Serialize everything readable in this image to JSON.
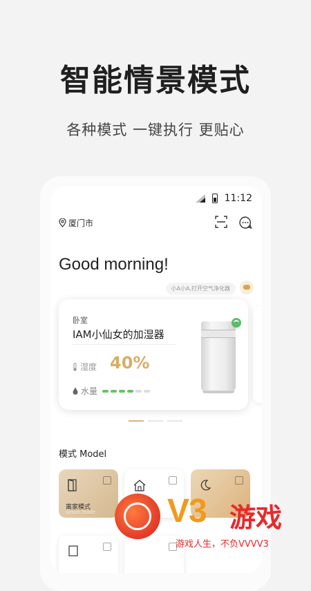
{
  "headline": "智能情景模式",
  "subline": "各种模式 一键执行 更贴心",
  "status_bar": {
    "time": "11:12"
  },
  "location": "厦门市",
  "greeting": "Good morning!",
  "assistant_prompt": "小A小A,打开空气净化器",
  "device_card": {
    "room": "卧室",
    "name": "IAM小仙女的加湿器",
    "humidity_label": "湿度",
    "humidity_value": "40%",
    "water_label": "水量",
    "water_level_filled": 4,
    "water_level_total": 6
  },
  "pager": {
    "pages": 3,
    "active": 0
  },
  "section_title": "模式 Model",
  "modes": [
    {
      "label": "离家模式",
      "sub": "Leave mode"
    },
    {
      "label": "",
      "sub": ""
    },
    {
      "label": "",
      "sub": ""
    }
  ],
  "watermark": {
    "brand": "V3",
    "brand_zh": "游戏",
    "slogan": "游戏人生，不负VVVV3"
  },
  "colors": {
    "accent_gold": "#d8ad62",
    "water_green": "#6cc167",
    "water_empty": "#dcdcdc",
    "watermark_red": "#e72a2a",
    "watermark_orange": "#f09a1e"
  }
}
